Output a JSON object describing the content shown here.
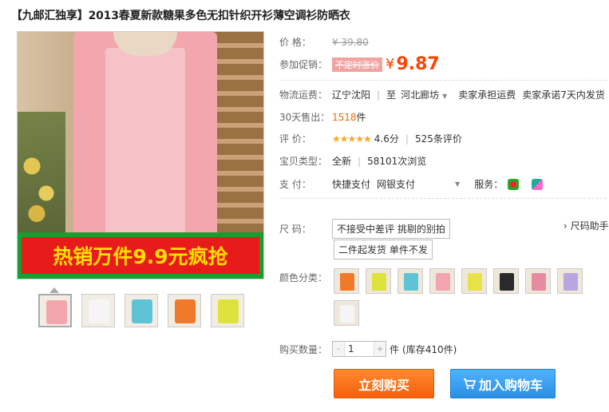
{
  "product": {
    "title": "【九邮汇独享】2013春夏新款糖果多色无扣针织开衫薄空调衫防晒衣",
    "banner_text": "热销万件9.9元疯抢"
  },
  "price": {
    "label": "价    格：",
    "original": "¥ 39.80"
  },
  "promo": {
    "label": "参加促销：",
    "tag": "不定时涨价",
    "currency": "¥",
    "value": "9.87"
  },
  "shipping": {
    "label": "物流运费：",
    "from": "辽宁沈阳",
    "to_prefix": "至",
    "to": "河北廊坊",
    "fee": "卖家承担运费",
    "promise": "卖家承诺7天内发货"
  },
  "sales": {
    "label": "30天售出：",
    "count": "1518",
    "unit": "件"
  },
  "rating": {
    "label": "评    价：",
    "stars": "★★★★★",
    "score": "4.6分",
    "reviews": "525条评价"
  },
  "item_type": {
    "label": "宝贝类型：",
    "condition": "全新",
    "views": "58101次浏览"
  },
  "payment": {
    "label": "支    付：",
    "method1": "快捷支付",
    "method2": "网银支付",
    "service_label": "服务："
  },
  "size": {
    "label": "尺    码：",
    "option1": "不接受中差评 挑剔的别拍",
    "option2": "二件起发货 单件不发",
    "helper": "› 尺码助手"
  },
  "color": {
    "label": "颜色分类：",
    "swatches": [
      "#f07a2a",
      "#dde23c",
      "#5fc3d6",
      "#f2a5b0",
      "#e8e24a",
      "#2a2a2a",
      "#e88aa0",
      "#b9a6e0",
      "#f5f5f5"
    ]
  },
  "quantity": {
    "label": "购买数量：",
    "value": "1",
    "unit": "件",
    "stock": "(库存410件)"
  },
  "actions": {
    "buy": "立刻购买",
    "cart": "加入购物车"
  },
  "thumbnails": [
    "#f3a6ad",
    "#f5f5f5",
    "#5fc3d6",
    "#f07a2a",
    "#dde23c"
  ]
}
